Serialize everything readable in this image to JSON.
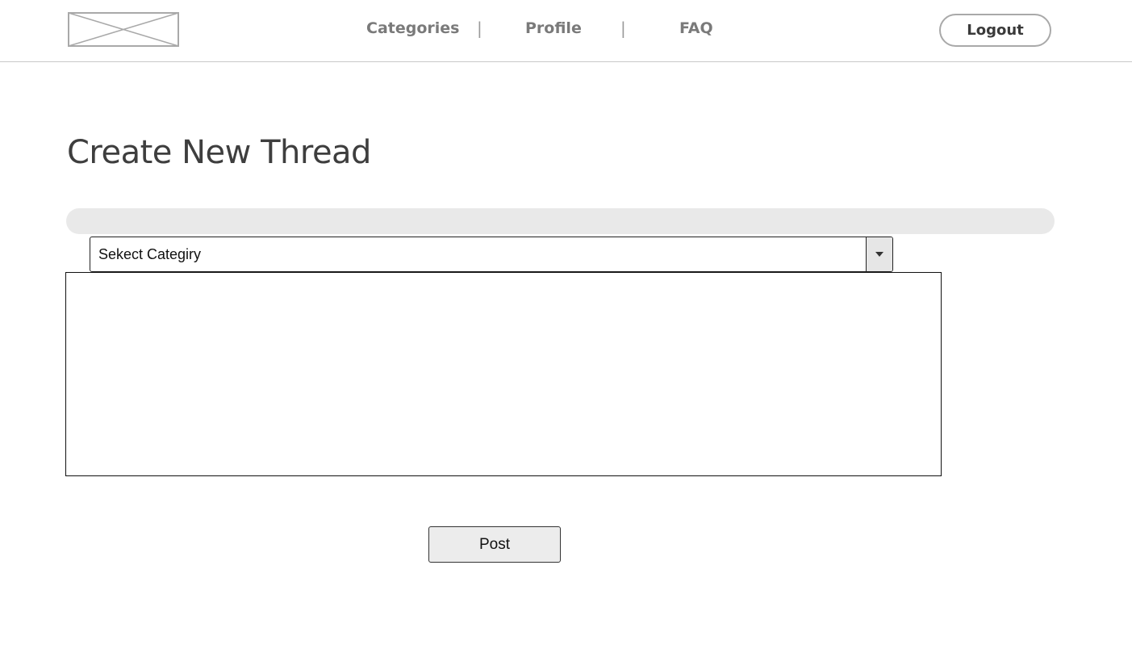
{
  "header": {
    "logo_icon": "image-placeholder-icon",
    "nav": [
      {
        "label": "Categories"
      },
      {
        "label": "Profile"
      },
      {
        "label": "FAQ"
      }
    ],
    "separator": "|",
    "logout_label": "Logout"
  },
  "main": {
    "title": "Create New Thread",
    "thread_title_value": "",
    "category_select": {
      "selected": "Sekect Categiry",
      "dropdown_icon": "caret-down-icon"
    },
    "thread_body_value": "",
    "post_label": "Post"
  },
  "colors": {
    "title_field_bg": "#e9e9e9",
    "nav_text": "#7a7a7a",
    "button_bg": "#ececec"
  }
}
